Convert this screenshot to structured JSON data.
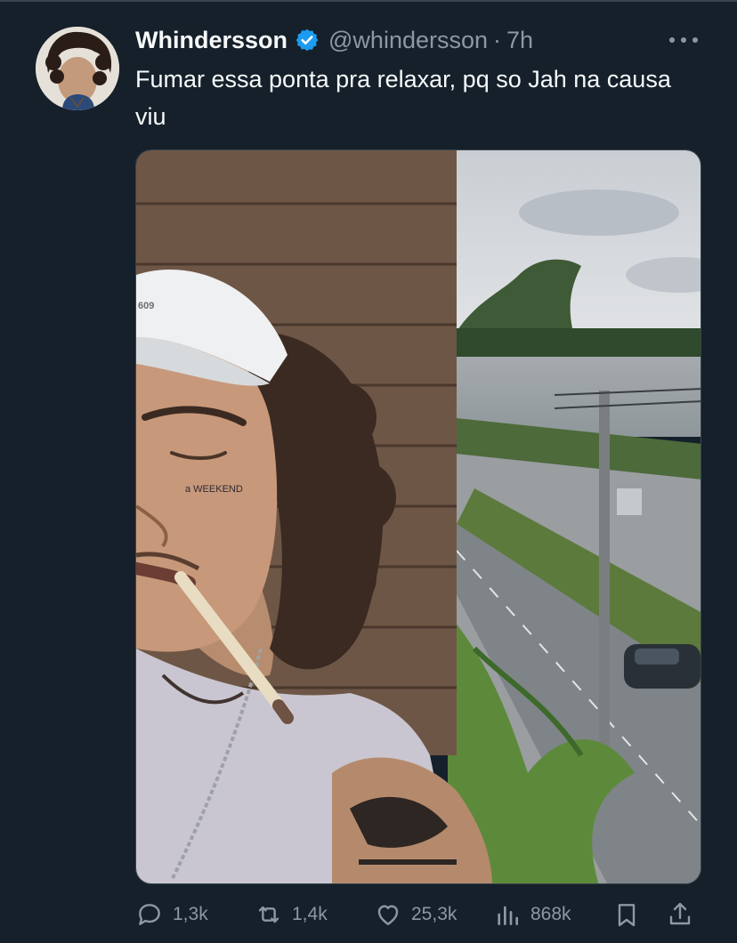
{
  "tweet": {
    "display_name": "Whindersson",
    "handle": "@whindersson",
    "separator": "·",
    "time": "7h",
    "text": "Fumar essa ponta pra relaxar, pq so Jah na causa viu"
  },
  "photo": {
    "cap_text": "609",
    "face_tattoo": "a WEEKEND"
  },
  "actions": {
    "replies": "1,3k",
    "reposts": "1,4k",
    "likes": "25,3k",
    "views": "868k"
  },
  "icons": {
    "verified": "verified-badge-icon",
    "more": "more-dots-icon",
    "reply": "reply-icon",
    "repost": "repost-icon",
    "like": "heart-icon",
    "views": "views-chart-icon",
    "bookmark": "bookmark-icon",
    "share": "share-icon"
  },
  "colors": {
    "background": "#15202b",
    "text_primary": "#f7f9f9",
    "text_secondary": "#8b98a5",
    "verified": "#1d9bf0"
  }
}
